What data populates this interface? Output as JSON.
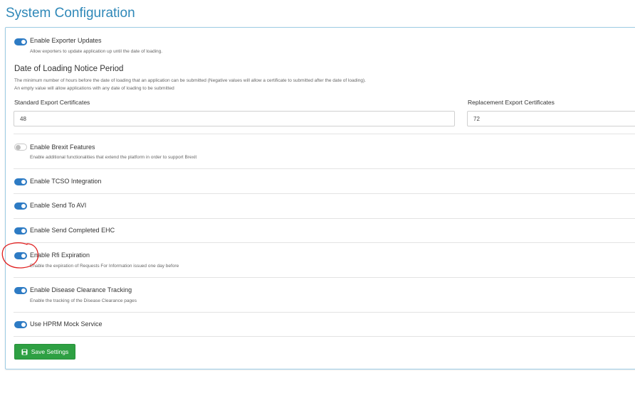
{
  "page": {
    "title": "System Configuration"
  },
  "settings": {
    "exporter_updates": {
      "label": "Enable Exporter Updates",
      "help": "Allow exporters to update application up until the date of loading.",
      "enabled": true
    },
    "notice_period": {
      "heading": "Date of Loading Notice Period",
      "desc_line1": "The minimum number of hours before the date of loading that an application can be submitted (Negative values will allow a certificate to submitted after the date of loading).",
      "desc_line2": "An empty value will allow applications with any date of loading to be submitted",
      "standard_label": "Standard Export Certificates",
      "standard_value": "48",
      "replacement_label": "Replacement Export Certificates",
      "replacement_value": "72"
    },
    "brexit": {
      "label": "Enable Brexit Features",
      "help": "Enable additional functionalities that extend the platform in order to support Brexit",
      "enabled": false
    },
    "tcso": {
      "label": "Enable TCSO Integration",
      "enabled": true
    },
    "send_avi": {
      "label": "Enable Send To AVI",
      "enabled": true
    },
    "send_ehc": {
      "label": "Enable Send Completed EHC",
      "enabled": true
    },
    "rfi_expiration": {
      "label": "Enable Rfi Expiration",
      "help": "Enable the expiration of Requests For Information issued one day before",
      "enabled": true
    },
    "disease_clearance": {
      "label": "Enable Disease Clearance Tracking",
      "help": "Enable the tracking of the Disease Clearance pages",
      "enabled": true
    },
    "hprm_mock": {
      "label": "Use HPRM Mock Service",
      "enabled": true
    }
  },
  "actions": {
    "save_label": "Save Settings",
    "save_icon": "floppy-disk-icon"
  },
  "colors": {
    "title": "#2f88b8",
    "toggle_on": "#2d7bc4",
    "save_button": "#2ea043",
    "annotation": "#e02020"
  }
}
